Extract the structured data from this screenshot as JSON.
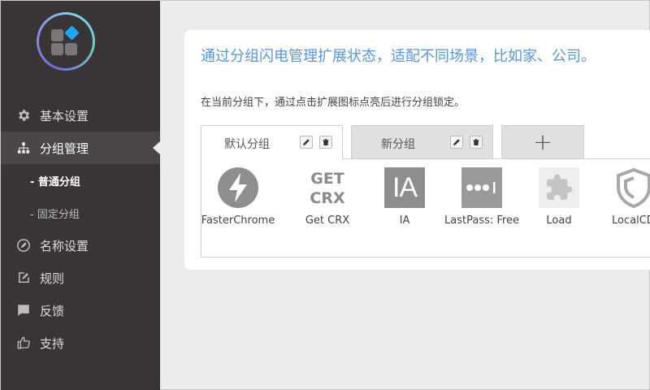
{
  "sidebar": {
    "items": [
      {
        "label": "基本设置",
        "icon": "gear-icon"
      },
      {
        "label": "分组管理",
        "icon": "org-chart-icon",
        "active": true
      },
      {
        "label": "名称设置",
        "icon": "pencil-circle-icon"
      },
      {
        "label": "规则",
        "icon": "edit-rules-icon"
      },
      {
        "label": "反馈",
        "icon": "chat-bubble-icon"
      },
      {
        "label": "支持",
        "icon": "thumbs-up-icon"
      }
    ],
    "subitems": [
      {
        "label": "- 普通分组",
        "active": true
      },
      {
        "label": "- 固定分组"
      }
    ]
  },
  "main": {
    "headline": "通过分组闪电管理扩展状态，适配不同场景，比如家、公司。",
    "description": "在当前分组下，通过点击扩展图标点亮后进行分组锁定。",
    "tabs": [
      {
        "label": "默认分组",
        "active": true
      },
      {
        "label": "新分组"
      }
    ],
    "add_tab_label": "+",
    "extensions": [
      {
        "name": "FasterChrome",
        "icon": "lightning-bolt-icon"
      },
      {
        "name": "Get CRX",
        "icon": "get-crx-icon",
        "icon_text": "GET CRX"
      },
      {
        "name": "IA",
        "icon": "ia-icon",
        "icon_text": "IA"
      },
      {
        "name": "LastPass: Free",
        "icon": "lastpass-icon"
      },
      {
        "name": "Load",
        "icon": "puzzle-piece-icon"
      },
      {
        "name": "LocalCD",
        "icon": "shield-icon"
      }
    ]
  },
  "colors": {
    "sidebar_bg": "#393536",
    "accent_blue": "#5a95d8",
    "icon_gray": "#8e8e8e"
  }
}
